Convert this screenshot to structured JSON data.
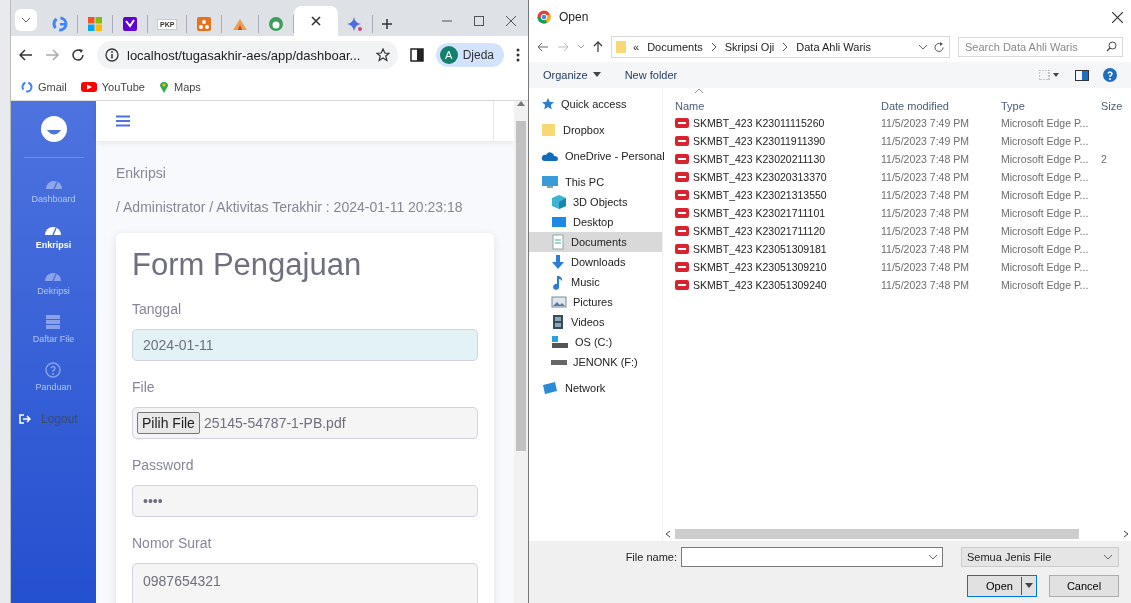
{
  "browser": {
    "tabs": [
      {
        "kind": "google",
        "selected": false
      },
      {
        "kind": "windows",
        "selected": false
      },
      {
        "kind": "yahoo",
        "selected": false
      },
      {
        "kind": "pkp",
        "label": "PKP",
        "selected": false
      },
      {
        "kind": "orange",
        "selected": false
      },
      {
        "kind": "camp",
        "selected": false
      },
      {
        "kind": "green",
        "selected": false
      },
      {
        "selected": true
      },
      {
        "kind": "sparkle",
        "selected": false
      }
    ],
    "address": "localhost/tugasakhir-aes/app/dashboar...",
    "profile": {
      "initial": "A",
      "name": "Djeda"
    },
    "bookmarks": [
      {
        "kind": "gmail",
        "label": "Gmail"
      },
      {
        "kind": "youtube",
        "label": "YouTube"
      },
      {
        "kind": "maps",
        "label": "Maps"
      }
    ]
  },
  "page": {
    "sidebar": [
      {
        "kind": "gauge",
        "label": "Dashboard",
        "selected": false
      },
      {
        "kind": "gauge",
        "label": "Enkripsi",
        "selected": true
      },
      {
        "kind": "gauge",
        "label": "Dekripsi",
        "selected": false
      },
      {
        "kind": "list",
        "label": "Daftar File",
        "selected": false
      },
      {
        "kind": "help",
        "label": "Panduan",
        "selected": false
      }
    ],
    "logout": "Logout",
    "heading": "Enkripsi",
    "breadcrumb": "/ Administrator / Aktivitas Terakhir : 2024-01-11 20:23:18",
    "form": {
      "title": "Form Pengajuan",
      "fields": [
        {
          "kind": "date",
          "label": "Tanggal",
          "value": "2024-01-11"
        },
        {
          "kind": "file",
          "label": "File",
          "button": "Pilih File",
          "value": "25145-54787-1-PB.pdf"
        },
        {
          "kind": "password",
          "label": "Password",
          "value": "••••"
        },
        {
          "kind": "textarea",
          "label": "Nomor Surat",
          "value": "0987654321"
        }
      ]
    }
  },
  "dialog": {
    "title": "Open",
    "path_prefix": "«",
    "path": [
      "Documents",
      "Skripsi Oji",
      "Data Ahli Waris"
    ],
    "search": {
      "placeholder": "Search Data Ahli Waris"
    },
    "toolbar": [
      "Organize",
      "New folder"
    ],
    "nav": [
      {
        "kind": "star",
        "label": "Quick access",
        "selected": false
      },
      {
        "kind": "folder",
        "label": "Dropbox",
        "selected": false
      },
      {
        "kind": "cloud",
        "label": "OneDrive - Personal",
        "selected": false
      },
      {
        "kind": "pc",
        "label": "This PC",
        "selected": false,
        "children": [
          {
            "kind": "cube",
            "label": "3D Objects",
            "selected": false
          },
          {
            "kind": "desktop",
            "label": "Desktop",
            "selected": false
          },
          {
            "kind": "doc",
            "label": "Documents",
            "selected": true
          },
          {
            "kind": "download",
            "label": "Downloads",
            "selected": false
          },
          {
            "kind": "music",
            "label": "Music",
            "selected": false
          },
          {
            "kind": "picture",
            "label": "Pictures",
            "selected": false
          },
          {
            "kind": "video",
            "label": "Videos",
            "selected": false
          },
          {
            "kind": "drive",
            "label": "OS (C:)",
            "selected": false
          },
          {
            "kind": "usb",
            "label": "JENONK (F:)",
            "selected": false
          }
        ]
      },
      {
        "kind": "network",
        "label": "Network",
        "selected": false
      }
    ],
    "columns": [
      "Name",
      "Date modified",
      "Type",
      "Size"
    ],
    "rows": [
      {
        "name": "SKMBT_423 K23011115260",
        "date": "11/5/2023 7:49 PM",
        "type": "Microsoft Edge P..."
      },
      {
        "name": "SKMBT_423 K23011911390",
        "date": "11/5/2023 7:49 PM",
        "type": "Microsoft Edge P..."
      },
      {
        "name": "SKMBT_423 K23020211130",
        "date": "11/5/2023 7:48 PM",
        "type": "Microsoft Edge P...",
        "size": "2"
      },
      {
        "name": "SKMBT_423 K23020313370",
        "date": "11/5/2023 7:48 PM",
        "type": "Microsoft Edge P..."
      },
      {
        "name": "SKMBT_423 K23021313550",
        "date": "11/5/2023 7:48 PM",
        "type": "Microsoft Edge P..."
      },
      {
        "name": "SKMBT_423 K23021711101",
        "date": "11/5/2023 7:48 PM",
        "type": "Microsoft Edge P..."
      },
      {
        "name": "SKMBT_423 K23021711120",
        "date": "11/5/2023 7:48 PM",
        "type": "Microsoft Edge P..."
      },
      {
        "name": "SKMBT_423 K23051309181",
        "date": "11/5/2023 7:48 PM",
        "type": "Microsoft Edge P..."
      },
      {
        "name": "SKMBT_423 K23051309210",
        "date": "11/5/2023 7:48 PM",
        "type": "Microsoft Edge P..."
      },
      {
        "name": "SKMBT_423 K23051309240",
        "date": "11/5/2023 7:48 PM",
        "type": "Microsoft Edge P..."
      }
    ],
    "file_name_label": "File name:",
    "filter": "Semua Jenis File",
    "buttons": [
      {
        "kind": "primary",
        "label": "Open"
      },
      {
        "kind": "secondary",
        "label": "Cancel"
      }
    ]
  }
}
